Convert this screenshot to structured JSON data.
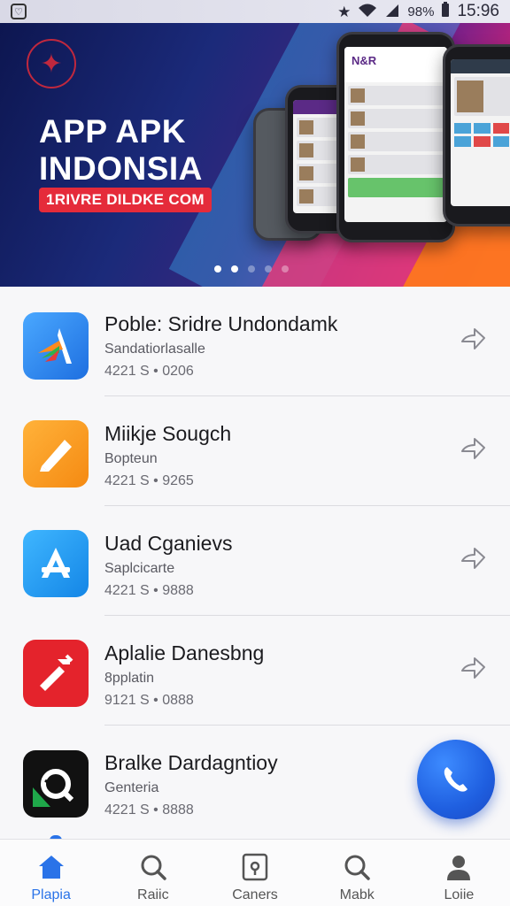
{
  "status_bar": {
    "battery": "98%",
    "time": "15:96",
    "left_icon": "app-notification-icon",
    "icons": [
      "star-icon",
      "wifi-icon",
      "signal-icon"
    ]
  },
  "hero": {
    "headline_line1": "APP APK",
    "headline_line2": "INDONSIA",
    "url_pill": "1RIVRE DILDKE COM",
    "phone_brand": "N&R",
    "carousel_total": 5,
    "carousel_active": 2,
    "colors": {
      "navy": "#0d1650",
      "magenta": "#c2247a",
      "orange": "#ff5a1e",
      "pill": "#e52b3a"
    }
  },
  "apps": [
    {
      "title": "Poble: Sridre Undondamk",
      "subtitle": "Sandatiorlasalle",
      "meta": "4221 S • 0206",
      "icon": "pen-tool-icon",
      "icon_color": "#2b86e6"
    },
    {
      "title": "Miikje Sougch",
      "subtitle": "Boptеun",
      "meta": "4221 S • 9265",
      "icon": "pencil-icon",
      "icon_color": "#f59b1c"
    },
    {
      "title": "Uad Cganievs",
      "subtitle": "Saplcicarte",
      "meta": "4221 S • 9888",
      "icon": "app-store-icon",
      "icon_color": "#1e9cef"
    },
    {
      "title": "Aplalie Danesbng",
      "subtitle": "8pplatin",
      "meta": "9121 S • 0888",
      "icon": "hammer-icon",
      "icon_color": "#e4232c"
    },
    {
      "title": "Bralke Dardagntioy",
      "subtitle": "Genteria",
      "meta": "4221 S • 8888",
      "icon": "search-app-icon",
      "icon_color": "#111111"
    }
  ],
  "fab": {
    "icon": "phone-icon",
    "color": "#1f5fe0"
  },
  "bottom_nav": [
    {
      "label": "Plapia",
      "icon": "home-icon",
      "active": true
    },
    {
      "label": "Raiic",
      "icon": "search-icon",
      "active": false
    },
    {
      "label": "Caners",
      "icon": "camera-icon",
      "active": false
    },
    {
      "label": "Mabk",
      "icon": "search-icon",
      "active": false
    },
    {
      "label": "Loiie",
      "icon": "user-icon",
      "active": false
    }
  ]
}
